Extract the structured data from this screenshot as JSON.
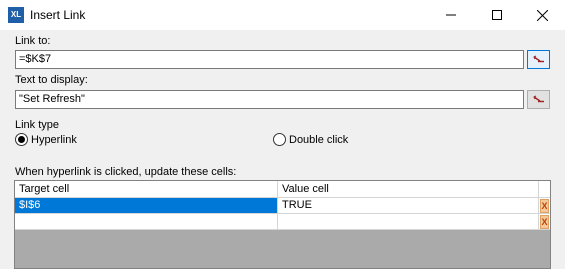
{
  "window": {
    "title": "Insert Link",
    "app_icon_text": "XL"
  },
  "link_to": {
    "label": "Link to:",
    "value": "=$K$7"
  },
  "text_to_display": {
    "label": "Text to display:",
    "value": "\"Set Refresh\""
  },
  "link_type": {
    "label": "Link type",
    "options": [
      {
        "label": "Hyperlink",
        "selected": true
      },
      {
        "label": "Double click",
        "selected": false
      }
    ]
  },
  "update_cells": {
    "label": "When hyperlink is clicked, update these cells:",
    "columns": [
      "Target cell",
      "Value cell"
    ],
    "rows": [
      {
        "target": "$I$6",
        "value": "TRUE",
        "delete_icon": "X"
      },
      {
        "target": "",
        "value": "",
        "delete_icon": "X"
      }
    ]
  },
  "icons": {
    "app": "xl-app-icon",
    "minimize": "minimize-icon",
    "maximize": "maximize-icon",
    "close": "close-icon",
    "range_picker": "range-picker-icon"
  }
}
